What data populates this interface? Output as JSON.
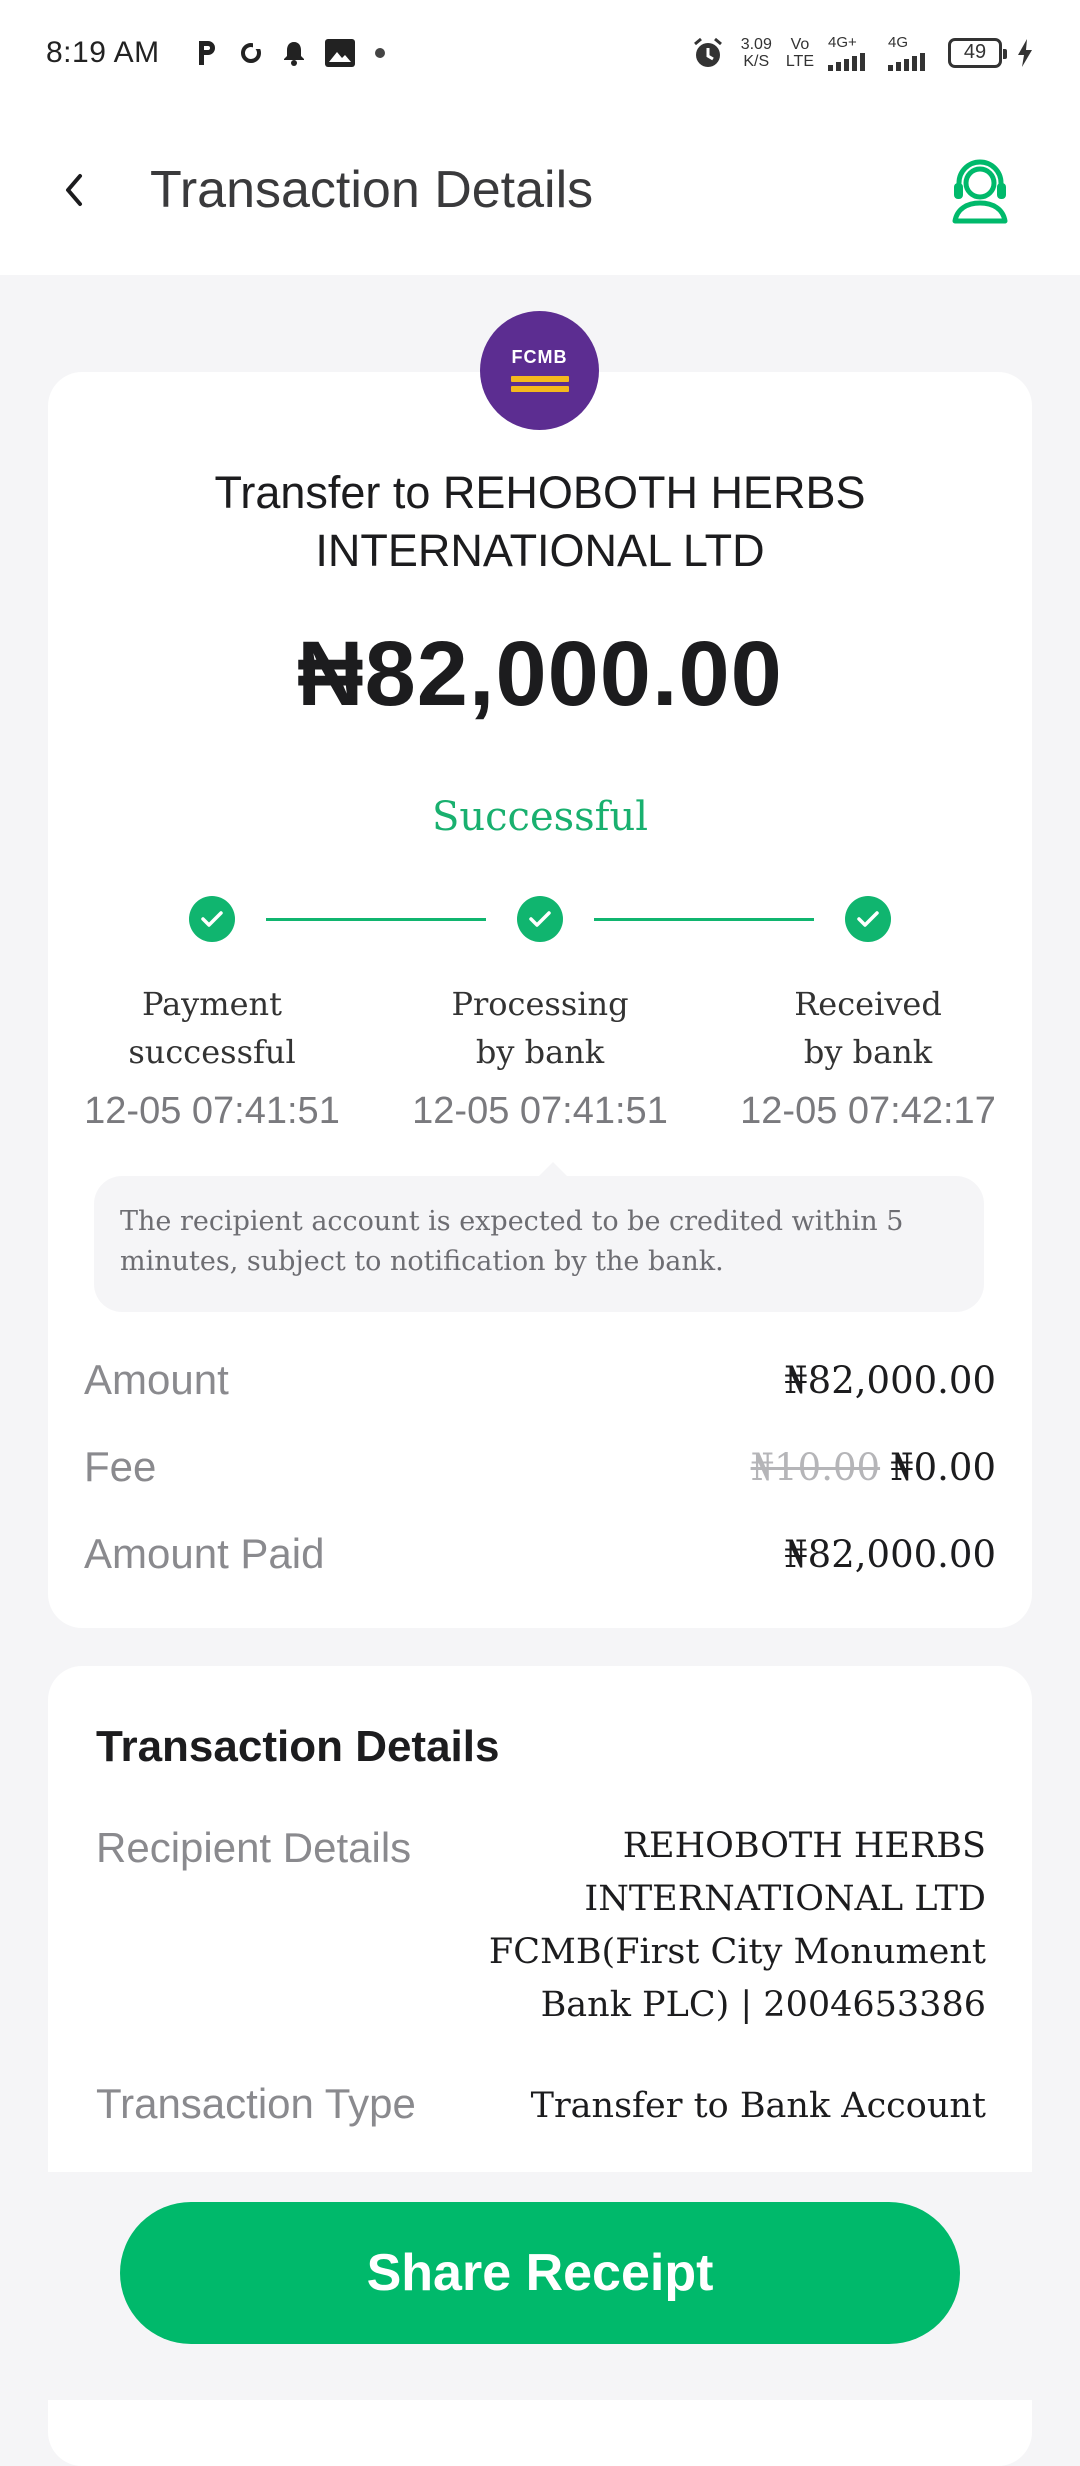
{
  "status_bar": {
    "time": "8:19 AM",
    "speed_value": "3.09",
    "speed_unit": "K/S",
    "volte_top": "Vo",
    "volte_bottom": "LTE",
    "net1": "4G+",
    "net2": "4G",
    "battery": "49"
  },
  "header": {
    "title": "Transaction Details"
  },
  "bank": {
    "logo_text": "FCMB",
    "logo_color": "#5c2d91",
    "logo_bar_color": "#f5b81c"
  },
  "transaction": {
    "title": "Transfer to REHOBOTH HERBS INTERNATIONAL LTD",
    "amount": "₦82,000.00",
    "status": "Successful",
    "steps": [
      {
        "label_line1": "Payment",
        "label_line2": "successful",
        "time": "12-05 07:41:51"
      },
      {
        "label_line1": "Processing",
        "label_line2": "by bank",
        "time": "12-05 07:41:51"
      },
      {
        "label_line1": "Received",
        "label_line2": "by bank",
        "time": "12-05 07:42:17"
      }
    ],
    "note": "The recipient account is expected to be credited within 5 minutes, subject to notification by the bank."
  },
  "summary": {
    "amount_label": "Amount",
    "amount_value": "₦82,000.00",
    "fee_label": "Fee",
    "fee_original": "₦10.00",
    "fee_value": "₦0.00",
    "paid_label": "Amount Paid",
    "paid_value": "₦82,000.00"
  },
  "details": {
    "title": "Transaction Details",
    "recipient_label": "Recipient Details",
    "recipient_name": "REHOBOTH HERBS INTERNATIONAL LTD",
    "recipient_bank": "FCMB(First City Monument Bank PLC) | 2004653386",
    "type_label": "Transaction Type",
    "type_value": "Transfer to Bank Account"
  },
  "actions": {
    "share_label": "Share Receipt"
  },
  "colors": {
    "accent": "#00b96b",
    "success_text": "#19b06f"
  }
}
